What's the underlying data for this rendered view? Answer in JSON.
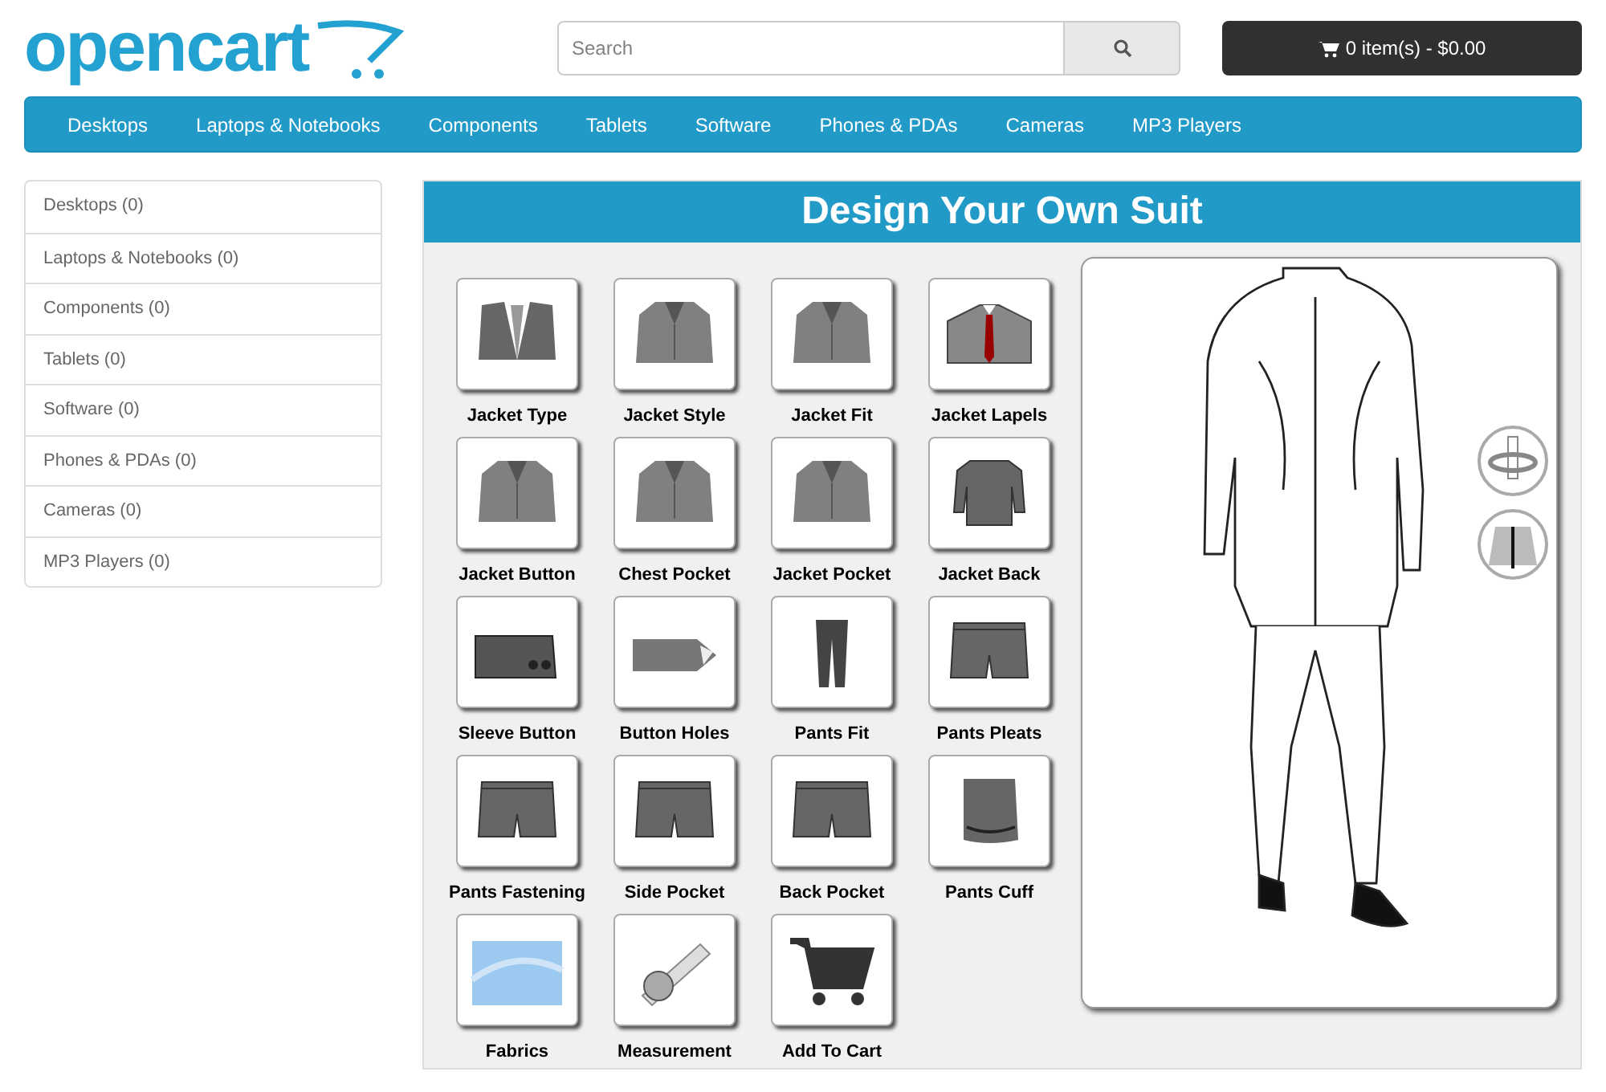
{
  "header": {
    "logo": "opencart",
    "search": {
      "placeholder": "Search"
    },
    "cart": "0 item(s) - $0.00"
  },
  "nav": [
    "Desktops",
    "Laptops & Notebooks",
    "Components",
    "Tablets",
    "Software",
    "Phones & PDAs",
    "Cameras",
    "MP3 Players"
  ],
  "sidebar": {
    "items": [
      "Desktops (0)",
      "Laptops & Notebooks (0)",
      "Components (0)",
      "Tablets (0)",
      "Software (0)",
      "Phones & PDAs (0)",
      "Cameras (0)",
      "MP3 Players (0)"
    ]
  },
  "designer": {
    "title": "Design Your Own Suit",
    "options": [
      {
        "label": "Jacket Type",
        "kind": "vest"
      },
      {
        "label": "Jacket Style",
        "kind": "jacket"
      },
      {
        "label": "Jacket Fit",
        "kind": "jacket"
      },
      {
        "label": "Jacket Lapels",
        "kind": "lapels"
      },
      {
        "label": "Jacket Button",
        "kind": "jacket"
      },
      {
        "label": "Chest Pocket",
        "kind": "jacket"
      },
      {
        "label": "Jacket Pocket",
        "kind": "jacket"
      },
      {
        "label": "Jacket Back",
        "kind": "back"
      },
      {
        "label": "Sleeve Button",
        "kind": "sleeve"
      },
      {
        "label": "Button Holes",
        "kind": "holes"
      },
      {
        "label": "Pants Fit",
        "kind": "pants"
      },
      {
        "label": "Pants Pleats",
        "kind": "shorts"
      },
      {
        "label": "Pants Fastening",
        "kind": "shorts"
      },
      {
        "label": "Side Pocket",
        "kind": "shorts"
      },
      {
        "label": "Back Pocket",
        "kind": "shorts"
      },
      {
        "label": "Pants Cuff",
        "kind": "cuff"
      },
      {
        "label": "Fabrics",
        "kind": "fabric"
      },
      {
        "label": "Measurement",
        "kind": "tape"
      },
      {
        "label": "Add To Cart",
        "kind": "cart"
      }
    ]
  }
}
